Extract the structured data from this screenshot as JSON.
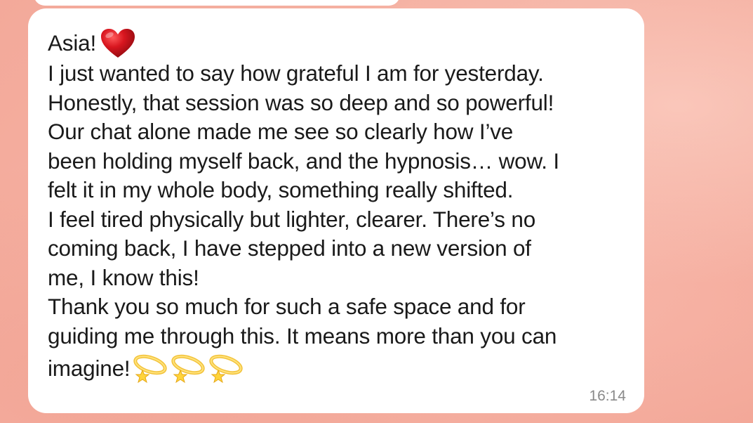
{
  "message": {
    "greeting": "Asia!",
    "greeting_emoji": "red-heart-icon",
    "lines": [
      "I just wanted to say how grateful I am for yesterday.",
      "Honestly, that session was so deep and so powerful!",
      "Our chat alone made me see so clearly how I’ve",
      "been holding myself back, and the hypnosis… wow. I",
      "felt it in my whole body, something really shifted.",
      "I feel tired physically but lighter, clearer. There’s no",
      "coming back, I have stepped into a new version of",
      "me, I know this!",
      "Thank you so much for such a safe space and for",
      "guiding me through this. It means more than you can"
    ],
    "last_line": "imagine!",
    "trailing_emojis": [
      "dizzy-halo-icon",
      "dizzy-halo-icon",
      "dizzy-halo-icon"
    ],
    "timestamp": "16:14"
  },
  "colors": {
    "background": "#f4ad9e",
    "bubble": "#ffffff",
    "text": "#1a1a1a",
    "timestamp": "#8a8a8a",
    "heart": "#c8141e"
  }
}
